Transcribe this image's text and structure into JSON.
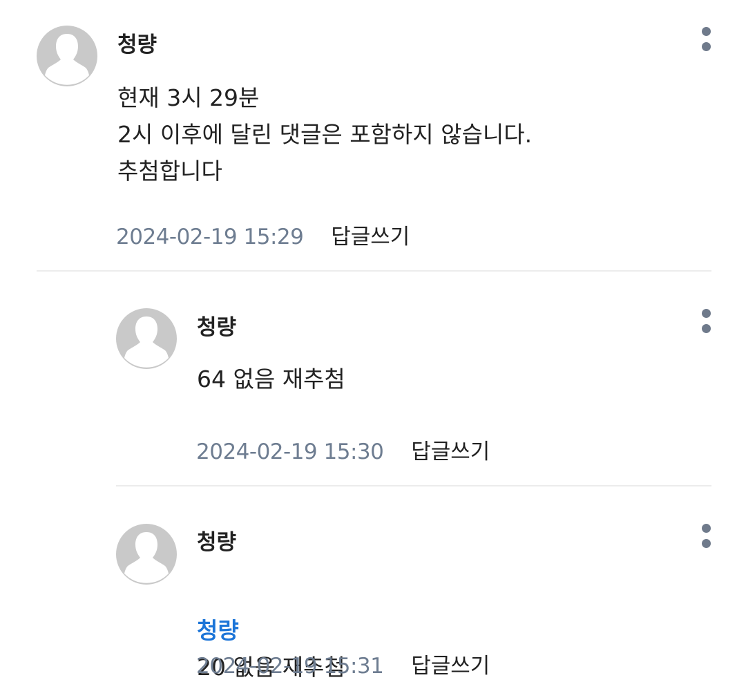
{
  "comments": [
    {
      "author": "청량",
      "body": "현재 3시 29분\n2시 이후에 달린 댓글은 포함하지 않습니다.\n추첨합니다",
      "timestamp": "2024-02-19 15:29",
      "reply_label": "답글쓰기"
    },
    {
      "author": "청량",
      "body": "64 없음 재추첨",
      "timestamp": "2024-02-19 15:30",
      "reply_label": "답글쓰기"
    },
    {
      "author": "청량",
      "mention": "청량",
      "body": "20 없음 재추첨",
      "timestamp": "2024-02-19 15:31",
      "reply_label": "답글쓰기"
    }
  ],
  "icons": {
    "avatar": "default-profile-icon",
    "more": "more-vertical-icon"
  },
  "colors": {
    "mention": "#1c75d8",
    "timestamp": "#6e7d91",
    "avatar_bg": "#c9c9c9",
    "more_dots": "#6f7a8b"
  }
}
